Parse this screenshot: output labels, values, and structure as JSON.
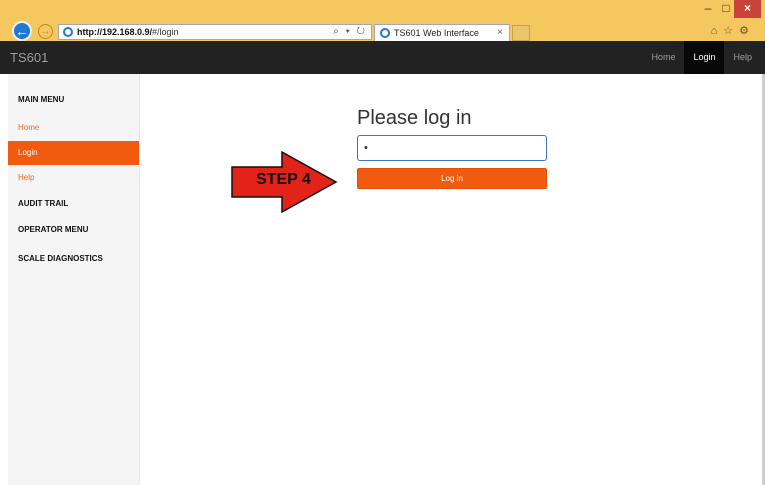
{
  "browser": {
    "url_host": "http://192.168.0.9/",
    "url_path": "#/login",
    "tab_title": "TS601 Web Interface",
    "address_tools": "⌕ ▾ ↻"
  },
  "header": {
    "brand": "TS601",
    "nav": [
      {
        "label": "Home"
      },
      {
        "label": "Login"
      },
      {
        "label": "Help"
      }
    ]
  },
  "sidebar": {
    "main_menu": "MAIN MENU",
    "items": [
      {
        "label": "Home"
      },
      {
        "label": "Login"
      },
      {
        "label": "Help"
      }
    ],
    "audit_trail": "AUDIT TRAIL",
    "operator_menu": "OPERATOR MENU",
    "scale_diagnostics": "SCALE DIAGNOSTICS"
  },
  "login": {
    "heading": "Please log in",
    "password_value": "•",
    "button": "Log in"
  },
  "annotation": {
    "step_label": "STEP 4"
  },
  "colors": {
    "accent": "#f25a0e",
    "navbar": "#222222",
    "arrow": "#e32219"
  }
}
